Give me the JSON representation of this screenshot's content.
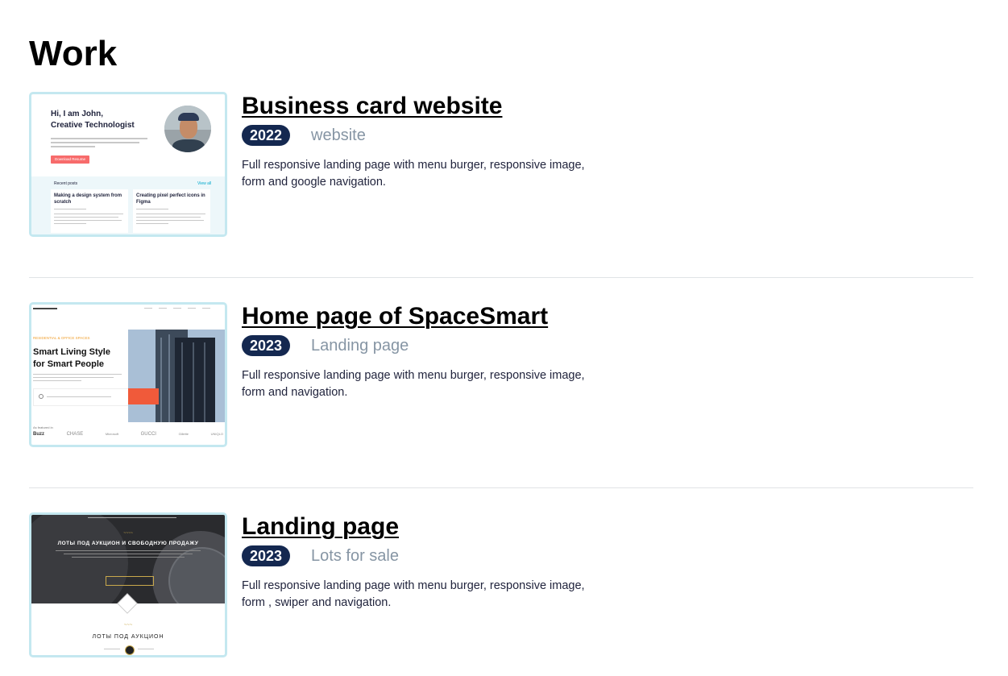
{
  "page": {
    "title": "Work"
  },
  "works": [
    {
      "title": "Business card website",
      "year": "2022",
      "category": "website",
      "description": "Full responsive landing page with menu burger, responsive image, form and google navigation.",
      "thumb": {
        "greeting_line1": "Hi, I am John,",
        "greeting_line2": "Creative Technologist",
        "button": "Download Resume",
        "section": "Recent posts",
        "view_all": "View all",
        "post1_title": "Making a design system from scratch",
        "post2_title": "Creating pixel perfect icons in Figma"
      }
    },
    {
      "title": "Home page of SpaceSmart",
      "year": "2023",
      "category": "Landing page",
      "description": "Full responsive landing page with menu burger, responsive image, form and navigation.",
      "thumb": {
        "kicker": "RESIDENTIAL & OFFICE SPACES",
        "headline1": "Smart Living Style",
        "headline2": "for Smart People",
        "brands": [
          "Buzz",
          "CHASE",
          "Microsoft",
          "GUCCI",
          "Gillette",
          "UNIQLO"
        ]
      }
    },
    {
      "title": "Landing page",
      "year": "2023",
      "category": "Lots for sale",
      "description": "Full responsive landing page with menu burger, responsive image, form , swiper and navigation.",
      "thumb": {
        "hero_title": "ЛОТЫ ПОД АУКЦИОН И СВОБОДНУЮ ПРОДАЖУ",
        "section_title": "ЛОТЫ ПОД АУКЦИОН"
      }
    }
  ]
}
